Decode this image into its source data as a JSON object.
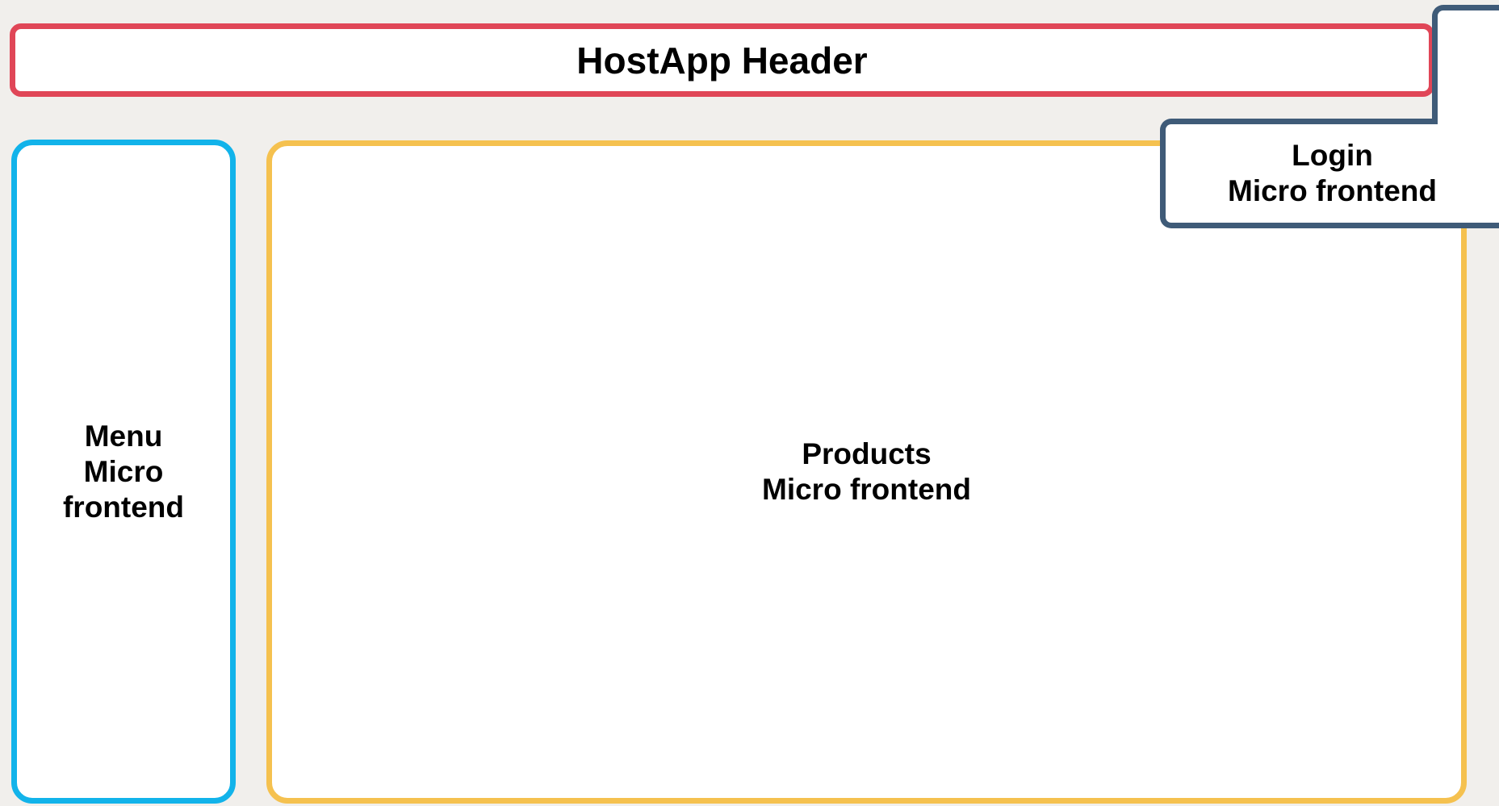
{
  "diagram": {
    "header": {
      "label": "HostApp Header",
      "border_color": "#e04657"
    },
    "menu": {
      "label": "Menu\nMicro\nfrontend",
      "border_color": "#12b3ea"
    },
    "products": {
      "label": "Products\nMicro frontend",
      "border_color": "#f5c14f"
    },
    "login": {
      "label": "Login\nMicro frontend",
      "border_color": "#3f5b78"
    },
    "background_color": "#f1efec"
  }
}
